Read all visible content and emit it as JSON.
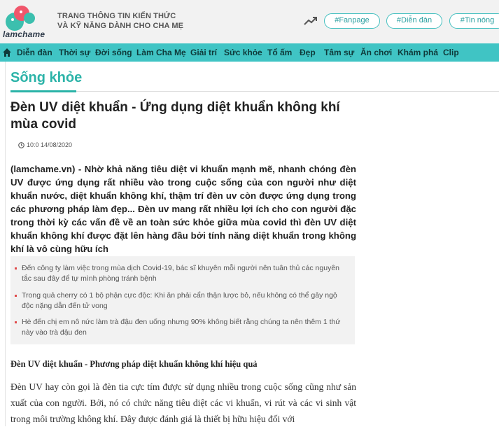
{
  "header": {
    "logo_text": "lamchame",
    "tagline_line1": "TRANG THÔNG TIN KIẾN THỨC",
    "tagline_line2": "VÀ KỸ NĂNG DÀNH CHO CHA MẸ",
    "trend_icon": "trending-up-icon",
    "pills": [
      "#Fanpage",
      "#Diễn đàn",
      "#Tin nóng"
    ]
  },
  "nav": {
    "home_icon": "home-icon",
    "items": [
      "Diễn đàn",
      "Thời sự",
      "Đời sống",
      "Làm Cha Mẹ",
      "Giải trí",
      "Sức khỏe",
      "Tổ ấm",
      "Đẹp",
      "Tâm sự",
      "Ăn chơi",
      "Khám phá",
      "Clip"
    ]
  },
  "article": {
    "section": "Sống khỏe",
    "title": "Đèn UV diệt khuẩn - Ứng dụng diệt khuẩn không khí mùa covid",
    "time": "10:0 14/08/2020",
    "lead": "(lamchame.vn) - Nhờ khả năng tiêu diệt vi khuẩn mạnh mẽ, nhanh chóng đèn UV được ứng dụng rất nhiều vào trong cuộc sống của con người như diệt khuẩn nước, diệt khuẩn không khí, thậm trí đèn uv còn được ứng dụng trong các phương pháp làm đẹp... Đèn uv mang rất nhiều lợi ích cho con người đặc trong thời kỳ các vấn đề về an toàn sức khỏe giữa mùa covid thì đèn UV diệt khuẩn không khí được đặt lên hàng đầu bởi tính năng diệt khuẩn trong không khí là vô cùng hữu ích",
    "related": [
      "Đến công ty làm việc trong mùa dịch Covid-19, bác sĩ khuyên mỗi người nên tuân thủ các nguyên tắc sau đây để tự mình phòng tránh bệnh",
      "Trong quả cherry có 1 bộ phận cực độc: Khi ăn phải cẩn thận lược bỏ, nếu không có thể gây ngộ độc nặng dẫn đến tử vong",
      "Hè đến chị em nô nức làm trà đậu đen uống nhưng 90% không biết rằng chúng ta nên thêm 1 thứ này vào trà đậu đen"
    ],
    "subhead": "Đèn UV diệt khuẩn - Phương pháp diệt khuẩn không khí hiệu quả",
    "body": "Đèn UV hay còn gọi là đèn tia cực tím được sử dụng nhiều trong cuộc sống cũng như sản xuất của con người. Bởi, nó có chức năng tiêu diệt các vi khuẩn, vi rút và các vi sinh vật trong môi trường không khí. Đây được đánh giá là thiết bị hữu hiệu đối với"
  },
  "colors": {
    "accent": "#40c4c4",
    "section": "#2bb3a8",
    "logo_pink": "#f0566b",
    "logo_teal": "#3cbfae",
    "bullet": "#e04a4a"
  }
}
